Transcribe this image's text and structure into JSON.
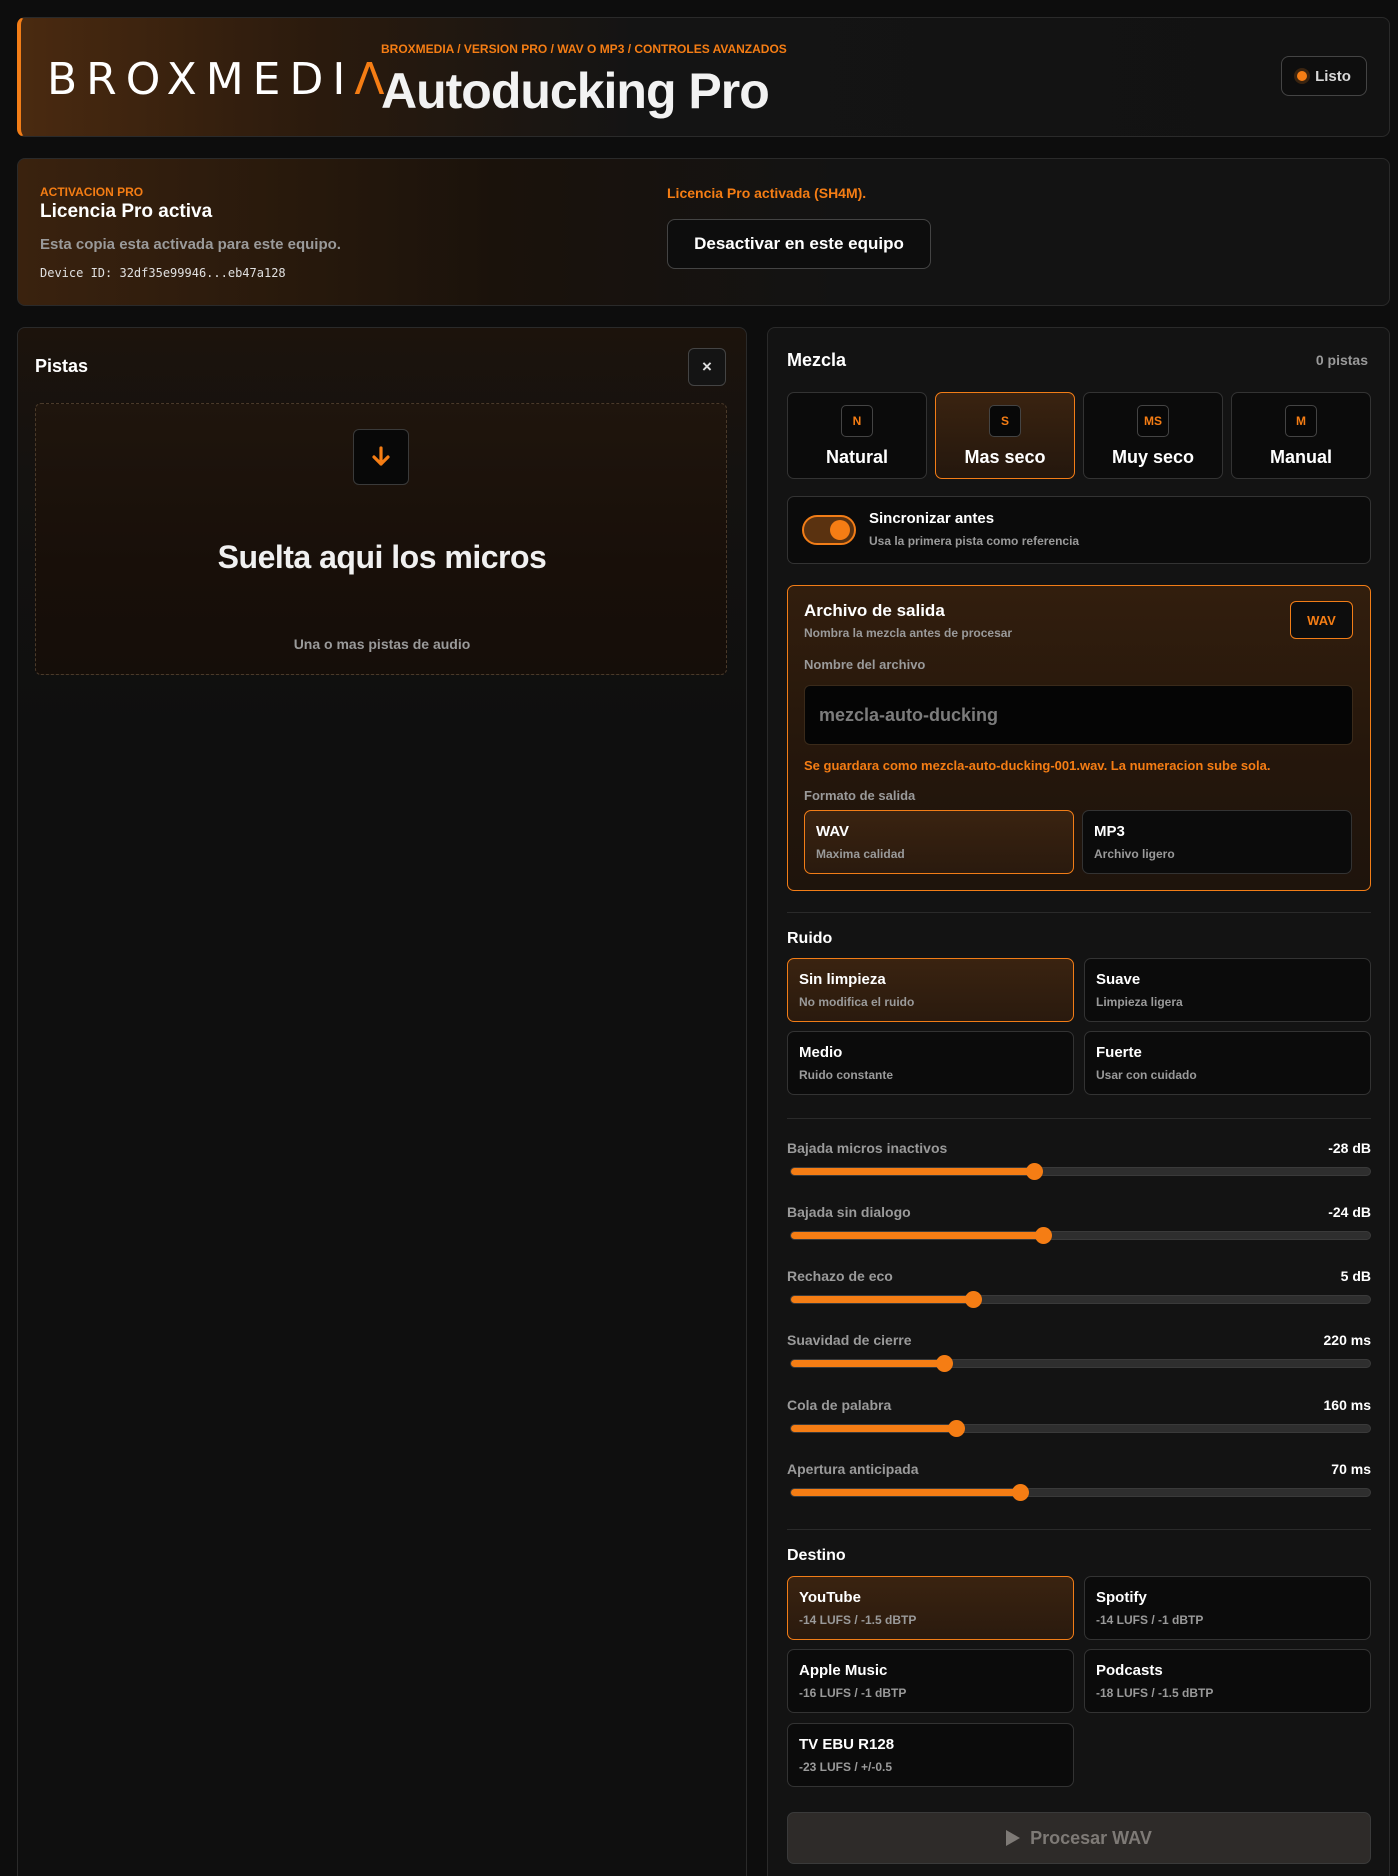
{
  "header": {
    "logo_prefix": "BROXMEDI",
    "logo_accent": "Λ",
    "breadcrumb": "BROXMEDIA / VERSION PRO / WAV O MP3 / CONTROLES AVANZADOS",
    "title": "Autoducking Pro",
    "status": "Listo"
  },
  "license": {
    "kicker": "ACTIVACION PRO",
    "title": "Licencia Pro activa",
    "subtitle": "Esta copia esta activada para este equipo.",
    "device_id": "Device ID: 32df35e99946...eb47a128",
    "status_text": "Licencia Pro activada (SH4M).",
    "deactivate_label": "Desactivar en este equipo"
  },
  "tracks": {
    "title": "Pistas",
    "close_label": "×",
    "dropzone_title": "Suelta aqui los micros",
    "dropzone_sub": "Una o mas pistas de audio"
  },
  "mix": {
    "title": "Mezcla",
    "count": "0 pistas",
    "presets": [
      {
        "badge": "N",
        "label": "Natural",
        "active": false
      },
      {
        "badge": "S",
        "label": "Mas seco",
        "active": true
      },
      {
        "badge": "MS",
        "label": "Muy seco",
        "active": false
      },
      {
        "badge": "M",
        "label": "Manual",
        "active": false
      }
    ],
    "sync": {
      "title": "Sincronizar antes",
      "subtitle": "Usa la primera pista como referencia",
      "enabled": true
    },
    "output": {
      "title": "Archivo de salida",
      "subtitle": "Nombra la mezcla antes de procesar",
      "badge": "WAV",
      "name_label": "Nombre del archivo",
      "name_placeholder": "mezcla-auto-ducking",
      "hint": "Se guardara como mezcla-auto-ducking-001.wav. La numeracion sube sola.",
      "format_label": "Formato de salida",
      "formats": [
        {
          "title": "WAV",
          "sub": "Maxima calidad",
          "active": true
        },
        {
          "title": "MP3",
          "sub": "Archivo ligero",
          "active": false
        }
      ]
    },
    "noise": {
      "title": "Ruido",
      "options": [
        {
          "title": "Sin limpieza",
          "sub": "No modifica el ruido",
          "active": true
        },
        {
          "title": "Suave",
          "sub": "Limpieza ligera",
          "active": false
        },
        {
          "title": "Medio",
          "sub": "Ruido constante",
          "active": false
        },
        {
          "title": "Fuerte",
          "sub": "Usar con cuidado",
          "active": false
        }
      ]
    },
    "sliders": [
      {
        "label": "Bajada micros inactivos",
        "value": "-28 dB",
        "level": 0.42
      },
      {
        "label": "Bajada sin dialogo",
        "value": "-24 dB",
        "level": 0.435
      },
      {
        "label": "Rechazo de eco",
        "value": "5 dB",
        "level": 0.315
      },
      {
        "label": "Suavidad de cierre",
        "value": "220 ms",
        "level": 0.265
      },
      {
        "label": "Cola de palabra",
        "value": "160 ms",
        "level": 0.285
      },
      {
        "label": "Apertura anticipada",
        "value": "70 ms",
        "level": 0.395
      }
    ],
    "destination": {
      "title": "Destino",
      "options": [
        {
          "title": "YouTube",
          "sub": "-14 LUFS / -1.5 dBTP",
          "active": true
        },
        {
          "title": "Spotify",
          "sub": "-14 LUFS / -1 dBTP",
          "active": false
        },
        {
          "title": "Apple Music",
          "sub": "-16 LUFS / -1 dBTP",
          "active": false
        },
        {
          "title": "Podcasts",
          "sub": "-18 LUFS / -1.5 dBTP",
          "active": false
        },
        {
          "title": "TV EBU R128",
          "sub": "-23 LUFS / +/-0.5",
          "active": false
        }
      ]
    },
    "process_label": "Procesar WAV"
  },
  "colors": {
    "accent": "#f57d14",
    "background": "#0d0d0d",
    "panel": "#131313"
  }
}
